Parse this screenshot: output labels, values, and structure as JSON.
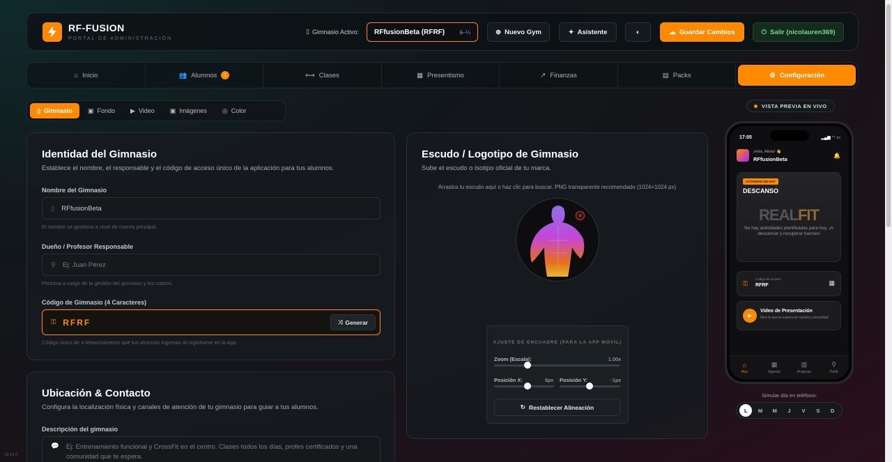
{
  "header": {
    "brand": "RF-FUSION",
    "subtitle": "PORTAL DE ADMINISTRACIÓN",
    "gym_label": "Gimnasio Activo:",
    "gym_selected": "RFfusionBeta (RFRF)",
    "gym_select_arrow": "â–¼",
    "new_gym": "Nuevo Gym",
    "assistant": "Asistente",
    "save": "Guardar Cambios",
    "logout": "Salir (nicolauren369)"
  },
  "nav": {
    "items": [
      {
        "label": "Inicio"
      },
      {
        "label": "Alumnos",
        "badge": "1"
      },
      {
        "label": "Clases"
      },
      {
        "label": "Presentismo"
      },
      {
        "label": "Finanzas"
      },
      {
        "label": "Packs"
      },
      {
        "label": "Configuración"
      }
    ]
  },
  "subtabs": [
    "Gimnasio",
    "Fondo",
    "Video",
    "Imágenes",
    "Color"
  ],
  "identity": {
    "title": "Identidad del Gimnasio",
    "desc": "Establece el nombre, el responsable y el código de acceso único de la aplicación para tus alumnos.",
    "name_label": "Nombre del Gimnasio",
    "name_value": "RFfusionBeta",
    "name_hint": "El nombre se gestiona a nivel de cuenta principal.",
    "owner_label": "Dueño / Profesor Responsable",
    "owner_placeholder": "Ej: Juan Pérez",
    "owner_hint": "Persona a cargo de la gestión del gimnasio y los cobros.",
    "code_label": "Código de Gimnasio (4 Caracteres)",
    "code_value": "RFRF",
    "generate": "Generar",
    "code_hint": "Código único de 4 letras/números que tus alumnos ingresan al registrarse en la App."
  },
  "location": {
    "title": "Ubicación & Contacto",
    "desc": "Configura la localización física y canales de atención de tu gimnasio para guiar a tus alumnos.",
    "desc_label": "Descripción del gimnasio",
    "desc_placeholder": "Ej: Entrenamiento funcional y CrossFit en el centro. Clases todos los días, profes certificados y una comunidad que te espera."
  },
  "crest": {
    "title": "Escudo / Logotipo de Gimnasio",
    "desc": "Sube el escudo o isotipo oficial de tu marca.",
    "drop_hint": "Arrastra tu escudo aquí o haz clic para buscar. PNG transparente recomendado (1024×1024 px)",
    "adjust_title": "AJUSTE DE ENCUADRE (PARA LA APP MÓVIL)",
    "zoom_label": "Zoom (Escala):",
    "zoom_value": "1.00x",
    "posx_label": "Posición X:",
    "posx_value": "6px",
    "posy_label": "Posición Y:",
    "posy_value": "-1px",
    "reset": "Restablecer Alineación"
  },
  "preview": {
    "badge": "VISTA PREVIA EN VIVO",
    "time": "17:05",
    "greeting": "¡Hola, Atleta! 👋",
    "gym_name": "RFfusionBeta",
    "today_tag": "ACTIVIDAD DE HOY",
    "rest": "DESCANSO",
    "logo_a": "REAL",
    "logo_b": "FIT",
    "no_activities": "No hay actividades planificadas para hoy. ¡A descansar y recuperar fuerzas!",
    "access_label": "Código de Acceso",
    "access_code": "RFRF",
    "video_title": "Video de Presentación",
    "video_sub": "Mira lo que te espera en nuestra comunidad",
    "tabs": [
      "Hoy",
      "Agenda",
      "Progreso",
      "Perfil"
    ],
    "sim_label": "Simular día en teléfono:",
    "days": [
      "L",
      "M",
      "M",
      "J",
      "V",
      "S",
      "D"
    ]
  },
  "version": "v3.14.0"
}
